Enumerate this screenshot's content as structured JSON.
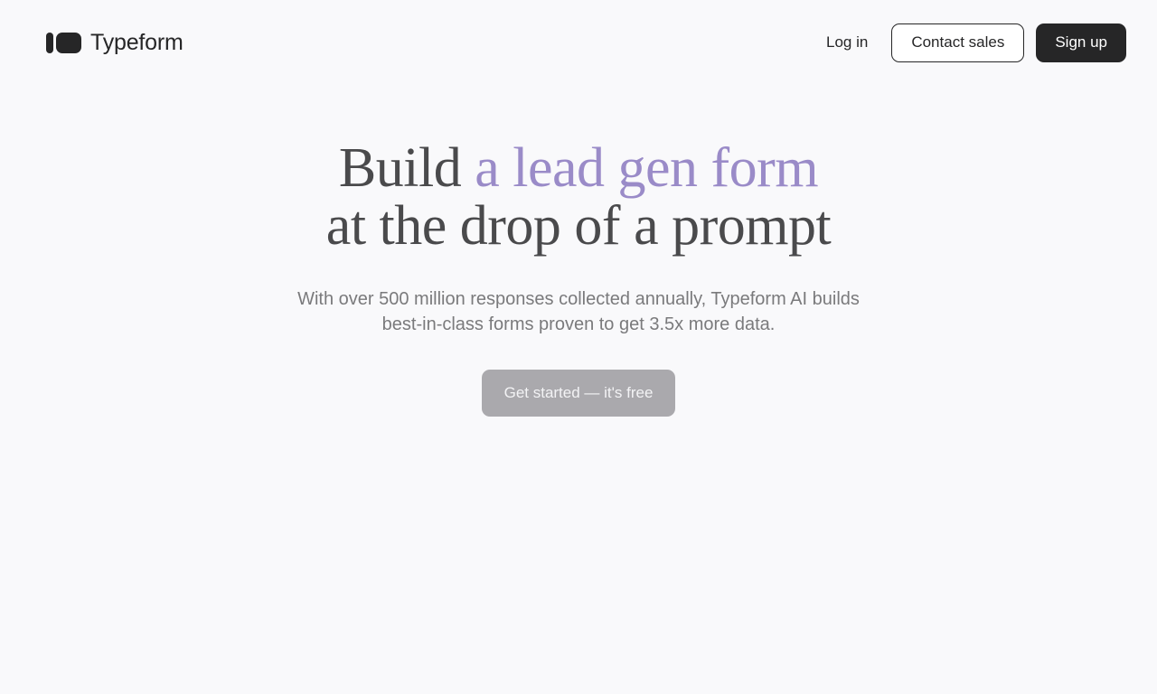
{
  "brand": {
    "name": "Typeform",
    "logo_icon": "typeform-logo-icon"
  },
  "nav": {
    "login_label": "Log in",
    "contact_label": "Contact sales",
    "signup_label": "Sign up"
  },
  "hero": {
    "title_part1": "Build ",
    "title_accent": "a lead gen form",
    "title_line2": "at the drop of a prompt",
    "subtitle_line1": "With over 500 million responses collected annually, Typeform AI builds",
    "subtitle_line2": "best-in-class forms proven to get 3.5x more data.",
    "cta_label": "Get started — it's free"
  },
  "colors": {
    "background": "#f9f9fb",
    "text_dark": "#262627",
    "accent": "#9a8bc8",
    "cta_bg": "#aaa9ad"
  }
}
